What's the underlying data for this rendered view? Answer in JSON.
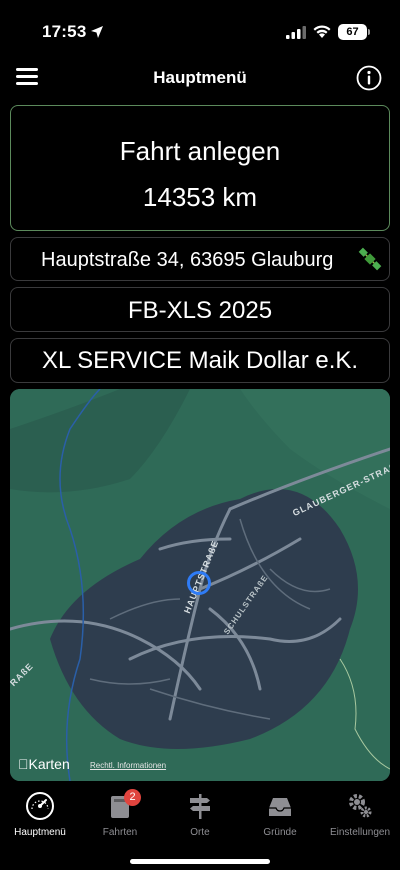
{
  "status_bar": {
    "time": "17:53",
    "battery": "67",
    "icons": [
      "location-arrow-icon",
      "cellular-signal-icon",
      "wifi-icon",
      "battery-icon"
    ]
  },
  "nav": {
    "title": "Hauptmenü",
    "left_icon": "hamburger-menu-icon",
    "right_icon": "info-icon"
  },
  "trip": {
    "title": "Fahrt anlegen",
    "odometer": "14353 km"
  },
  "address": {
    "text": "Hauptstraße 34, 63695 Glauburg",
    "icon": "satellite-icon"
  },
  "plate": "FB-XLS 2025",
  "company": "XL SERVICE Maik Dollar e.K.",
  "map": {
    "streets": {
      "haupt": "HAUPTSTRAßE",
      "schul": "SCHULSTRAßE",
      "glauberger": "GLAUBERGER-STRAßE",
      "partial": "RAßE"
    },
    "attribution_logo": "Karten",
    "legal": "Rechtl. Informationen"
  },
  "tabs": [
    {
      "label": "Hauptmenü",
      "icon": "speedometer-icon",
      "active": true
    },
    {
      "label": "Fahrten",
      "icon": "book-icon",
      "badge": "2"
    },
    {
      "label": "Orte",
      "icon": "signpost-icon"
    },
    {
      "label": "Gründe",
      "icon": "tray-icon"
    },
    {
      "label": "Einstellungen",
      "icon": "gears-icon"
    }
  ],
  "colors": {
    "accent_border": "#5c8a5c",
    "map_green": "#2f6a57",
    "location_blue": "#2f7cf6",
    "badge_red": "#e0443e"
  }
}
